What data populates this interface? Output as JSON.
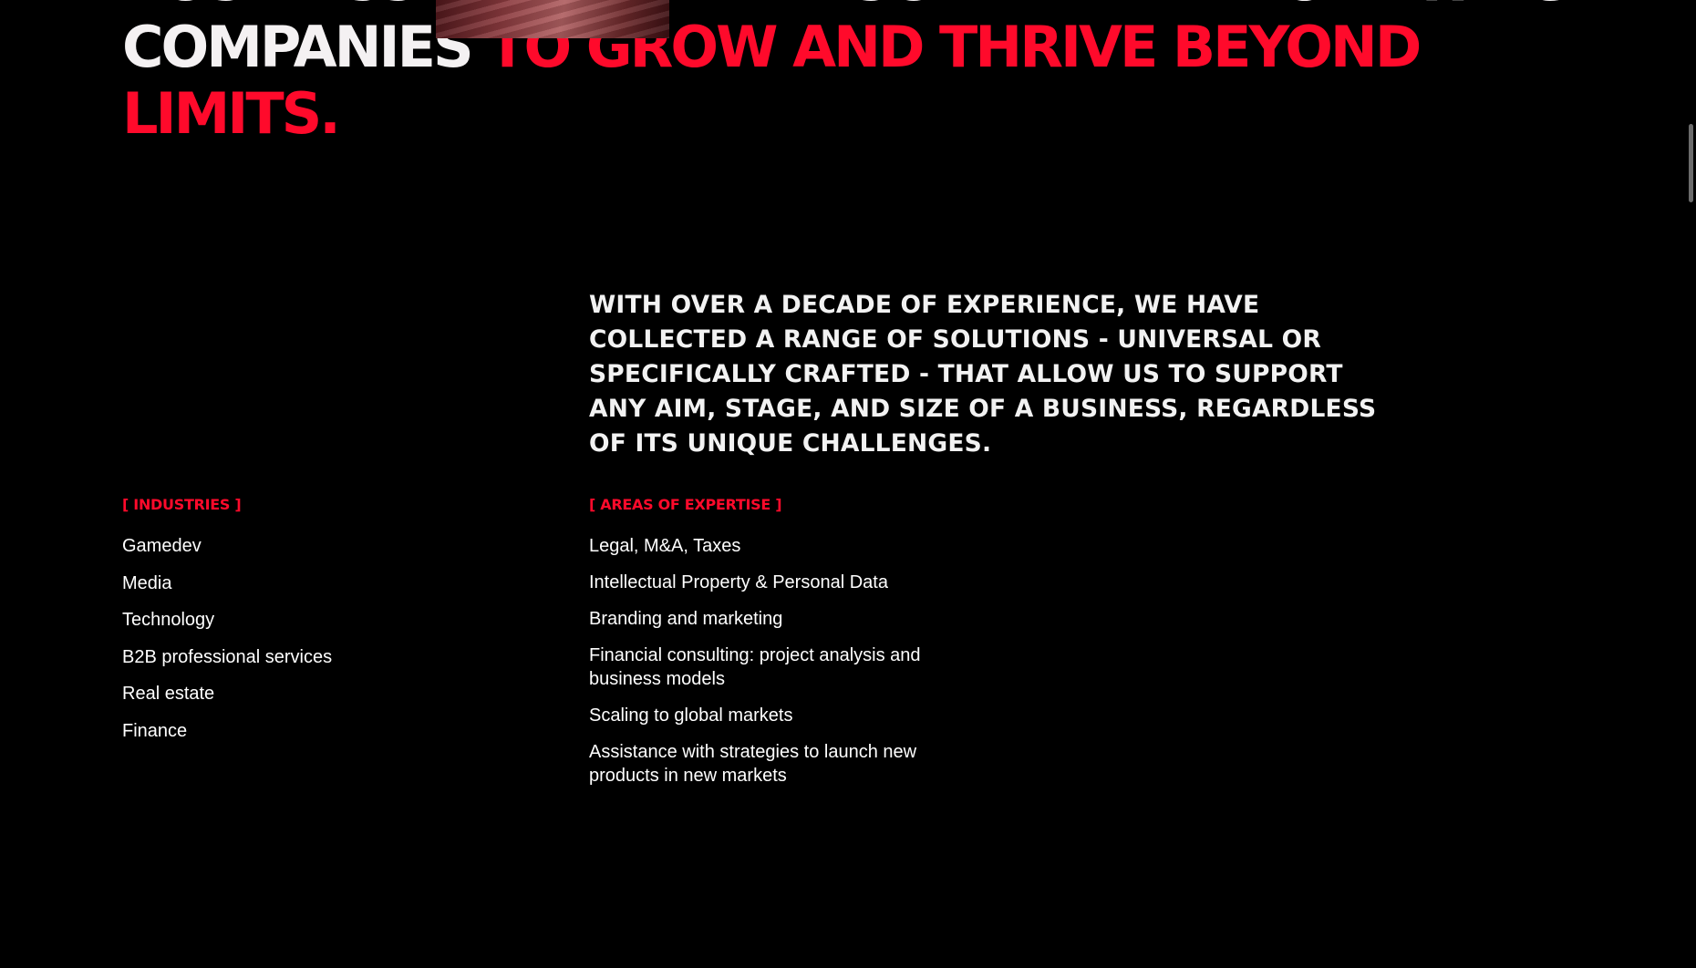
{
  "hero": {
    "line1_a": "Business",
    "line1_b": "landscape by empowering",
    "line2_a": "companies",
    "line2_b": "to grow and thrive beyond",
    "line3": "limits."
  },
  "intro": {
    "text": "With over a decade of experience, we have collected a range of solutions - universal or specifically crafted - that allow us to support any aim, stage, and size of a business, regardless of its unique challenges."
  },
  "industries": {
    "bracket_open": "[",
    "heading": "Industries",
    "bracket_close": "]",
    "items": [
      "Gamedev",
      "Media",
      "Technology",
      "B2B professional services",
      "Real estate",
      "Finance"
    ]
  },
  "expertise": {
    "bracket_open": "[",
    "heading": "Areas of expertise",
    "bracket_close": "]",
    "items": [
      "Legal, M&A, Taxes",
      "Intellectual Property & Personal Data",
      "Branding and marketing",
      "Financial consulting: project analysis and business models",
      "Scaling to global markets",
      "Assistance with strategies to launch new products in new markets"
    ]
  },
  "theme": {
    "background": "#000000",
    "text": "#ffffff",
    "accent": "#ff0a2b"
  }
}
